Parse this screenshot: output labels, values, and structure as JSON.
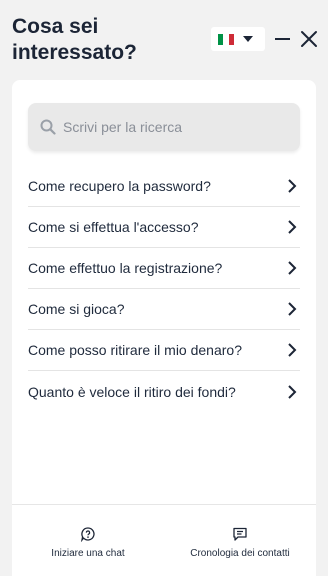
{
  "header": {
    "title": "Cosa sei interessato?",
    "language": {
      "flag_colors": [
        "#009246",
        "#ffffff",
        "#ce2b37"
      ],
      "icon": "italy-flag-icon"
    },
    "minimize_icon": "minimize-icon",
    "close_icon": "close-icon"
  },
  "search": {
    "placeholder": "Scrivi per la ricerca",
    "icon": "search-icon"
  },
  "faq": {
    "items": [
      {
        "label": "Come recupero la password?"
      },
      {
        "label": "Come si effettua l'accesso?"
      },
      {
        "label": "Come effettuo la registrazione?"
      },
      {
        "label": "Come si gioca?"
      },
      {
        "label": "Come posso ritirare il mio denaro?"
      },
      {
        "label": "Quanto è veloce il ritiro dei fondi?"
      }
    ]
  },
  "footer": {
    "start_chat_label": "Iniziare una chat",
    "history_label": "Cronologia dei contatti"
  }
}
